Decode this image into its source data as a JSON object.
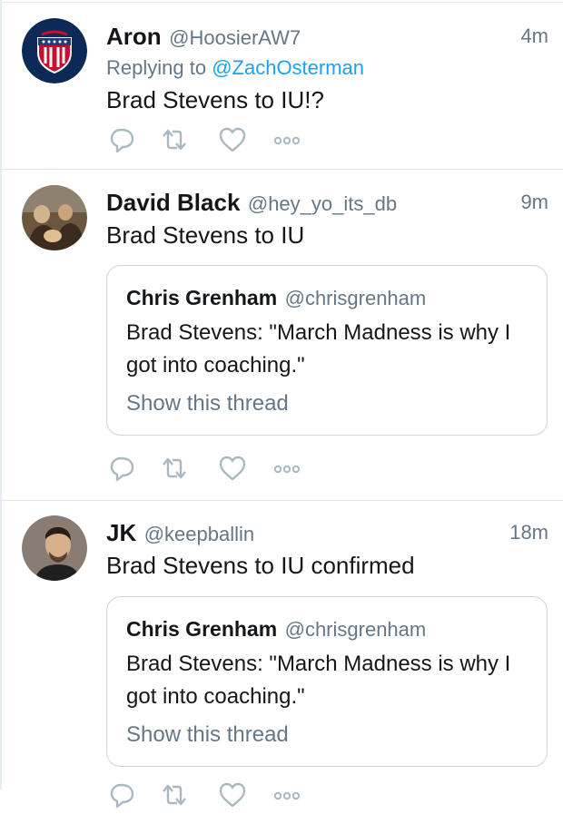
{
  "tweets": [
    {
      "name": "Aron",
      "handle": "@HoosierAW7",
      "time": "4m",
      "replying_prefix": "Replying to",
      "replying_to": "@ZachOsterman",
      "text": "Brad Stevens to IU!?",
      "avatar": "shield-logo-avatar"
    },
    {
      "name": "David Black",
      "handle": "@hey_yo_its_db",
      "time": "9m",
      "text": "Brad Stevens to IU",
      "avatar": "group-photo-avatar",
      "quote": {
        "name": "Chris Grenham",
        "handle": "@chrisgrenham",
        "text": "Brad Stevens: \"March Madness is why I got into coaching.\"",
        "show_thread": "Show this thread"
      }
    },
    {
      "name": "JK",
      "handle": "@keepballin",
      "time": "18m",
      "text": "Brad Stevens to IU confirmed",
      "avatar": "portrait-photo-avatar",
      "quote": {
        "name": "Chris Grenham",
        "handle": "@chrisgrenham",
        "text": "Brad Stevens: \"March Madness is why I got into coaching.\"",
        "show_thread": "Show this thread"
      }
    }
  ],
  "action_icons": [
    "reply-icon",
    "retweet-icon",
    "like-icon",
    "more-icon"
  ],
  "colors": {
    "link": "#1da1f2",
    "secondary_text": "#657786",
    "border": "#e1e8ed",
    "icon": "#aab8c2"
  }
}
